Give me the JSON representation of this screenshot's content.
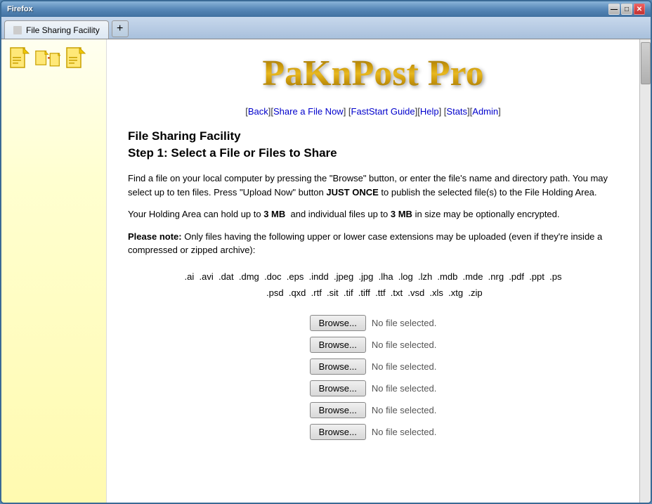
{
  "browser": {
    "title": "Firefox",
    "tab_title": "File Sharing Facility",
    "tab_new_label": "+",
    "controls": {
      "minimize": "—",
      "maximize": "□",
      "close": "✕"
    }
  },
  "nav": {
    "links": [
      {
        "label": "Back",
        "href": "#"
      },
      {
        "label": "Share a File Now",
        "href": "#"
      },
      {
        "label": "FastStart Guide",
        "href": "#"
      },
      {
        "label": "Help",
        "href": "#"
      },
      {
        "label": "Stats",
        "href": "#"
      },
      {
        "label": "Admin",
        "href": "#"
      }
    ]
  },
  "page": {
    "logo": "PaKnPost Pro",
    "title": "File Sharing Facility",
    "subtitle": "Step 1: Select a File or Files to Share",
    "description": "Find a file on your local computer by pressing the \"Browse\" button, or enter the file's name and directory path. You may select up to ten files. Press \"Upload Now\" button JUST ONCE to publish the selected file(s) to the File Holding Area.",
    "holding_info_prefix": "Your Holding Area can hold up to ",
    "holding_area_size": "3 MB",
    "holding_info_middle": " and individual files up to ",
    "individual_size": "3 MB",
    "holding_info_suffix": " in size may be optionally encrypted.",
    "note_label": "Please note:",
    "note_text": " Only files having the following upper or lower case extensions may be uploaded (even if they're inside a compressed or zipped archive):",
    "extensions": ".ai  .avi  .dat  .dmg  .doc  .eps  .indd  .jpeg  .jpg  .lha  .log  .lzh  .mdb  .mde  .nrg  .pdf  .ppt  .ps  .psd  .qxd  .rtf  .sit  .tif  .tiff  .ttf  .txt  .vsd  .xls  .xtg  .zip",
    "file_rows": [
      {
        "button_label": "Browse...",
        "file_text": "No file selected."
      },
      {
        "button_label": "Browse...",
        "file_text": "No file selected."
      },
      {
        "button_label": "Browse...",
        "file_text": "No file selected."
      },
      {
        "button_label": "Browse...",
        "file_text": "No file selected."
      },
      {
        "button_label": "Browse...",
        "file_text": "No file selected."
      },
      {
        "button_label": "Browse...",
        "file_text": "No file selected."
      }
    ]
  }
}
